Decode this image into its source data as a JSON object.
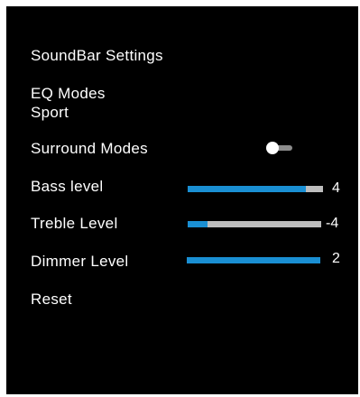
{
  "menu": {
    "title": "SoundBar Settings",
    "eq_label": "EQ Modes",
    "eq_value": "Sport",
    "surround_label": "Surround Modes",
    "surround_on": false,
    "bass": {
      "label": "Bass level",
      "value": "4",
      "fill": 0.87
    },
    "treble": {
      "label": "Treble Level",
      "value": "-4",
      "fill": 0.15
    },
    "dimmer": {
      "label": "Dimmer Level",
      "value": "2",
      "fill": 1.0
    },
    "reset_label": "Reset"
  },
  "colors": {
    "background": "#000000",
    "text": "#ffffff",
    "slider_fill": "#1a8fd3",
    "slider_track": "#bdbdbd",
    "toggle_track": "#8c8c8c"
  }
}
